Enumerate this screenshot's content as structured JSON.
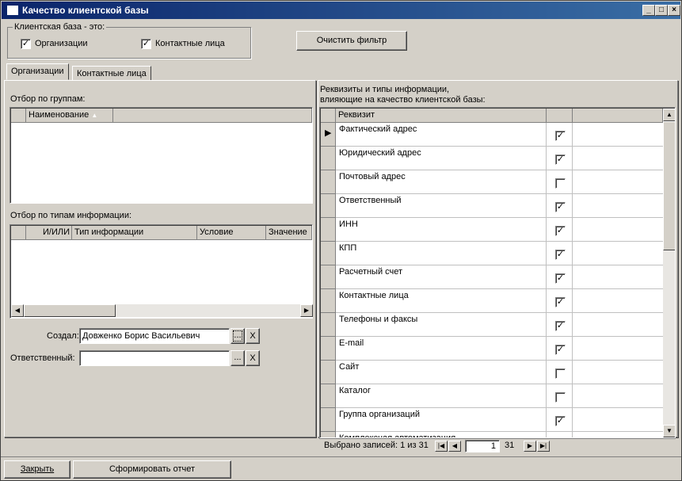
{
  "window": {
    "title": "Качество клиентской базы",
    "min": "_",
    "max": "□",
    "close": "×"
  },
  "base_group": {
    "legend": "Клиентская база - это:",
    "org_label": "Организации",
    "org_checked": "✓",
    "contacts_label": "Контактные лица",
    "contacts_checked": "✓"
  },
  "clear_filter": "Очистить фильтр",
  "tabs": [
    {
      "label": "Организации"
    },
    {
      "label": "Контактные лица"
    }
  ],
  "groups_filter": {
    "label": "Отбор по группам:",
    "col_name": "Наименование",
    "sort_arrow": "▲"
  },
  "info_filter": {
    "label": "Отбор по типам информации:",
    "cols": [
      "И/ИЛИ",
      "Тип информации",
      "Условие",
      "Значение"
    ]
  },
  "created": {
    "label": "Создал:",
    "value": "Довженко Борис  Васильевич",
    "pick": "...",
    "clear": "X"
  },
  "responsible": {
    "label": "Ответственный:",
    "value": "",
    "pick": "...",
    "clear": "X"
  },
  "requisites": {
    "title_line1": "Реквизиты и типы информации,",
    "title_line2": "влияющие на качество клиентской базы:",
    "col_name": "Реквизит",
    "current_marker": "▶",
    "rows": [
      {
        "name": "Фактический адрес",
        "check": "✓"
      },
      {
        "name": "Юридический адрес",
        "check": "✓"
      },
      {
        "name": "Почтовый адрес",
        "check": ""
      },
      {
        "name": "Ответственный",
        "check": "✓"
      },
      {
        "name": "ИНН",
        "check": "✓"
      },
      {
        "name": "КПП",
        "check": "✓"
      },
      {
        "name": "Расчетный счет",
        "check": "✓"
      },
      {
        "name": "Контактные лица",
        "check": "✓"
      },
      {
        "name": "Телефоны и факсы",
        "check": "✓"
      },
      {
        "name": "E-mail",
        "check": "✓"
      },
      {
        "name": "Сайт",
        "check": ""
      },
      {
        "name": "Каталог",
        "check": ""
      },
      {
        "name": "Группа организаций",
        "check": "✓"
      },
      {
        "name": "Комплексная автоматизация",
        "check": ""
      }
    ],
    "status_text": "Выбрано записей: 1 из 31",
    "page_current": "1",
    "page_total": "31",
    "nav_first": "|◀",
    "nav_prev": "◀",
    "nav_next": "▶",
    "nav_last": "▶|"
  },
  "scroll": {
    "up": "▲",
    "down": "▼",
    "left": "◀",
    "right": "▶"
  },
  "footer": {
    "close": "Закрыть",
    "report": "Сформировать отчет"
  }
}
